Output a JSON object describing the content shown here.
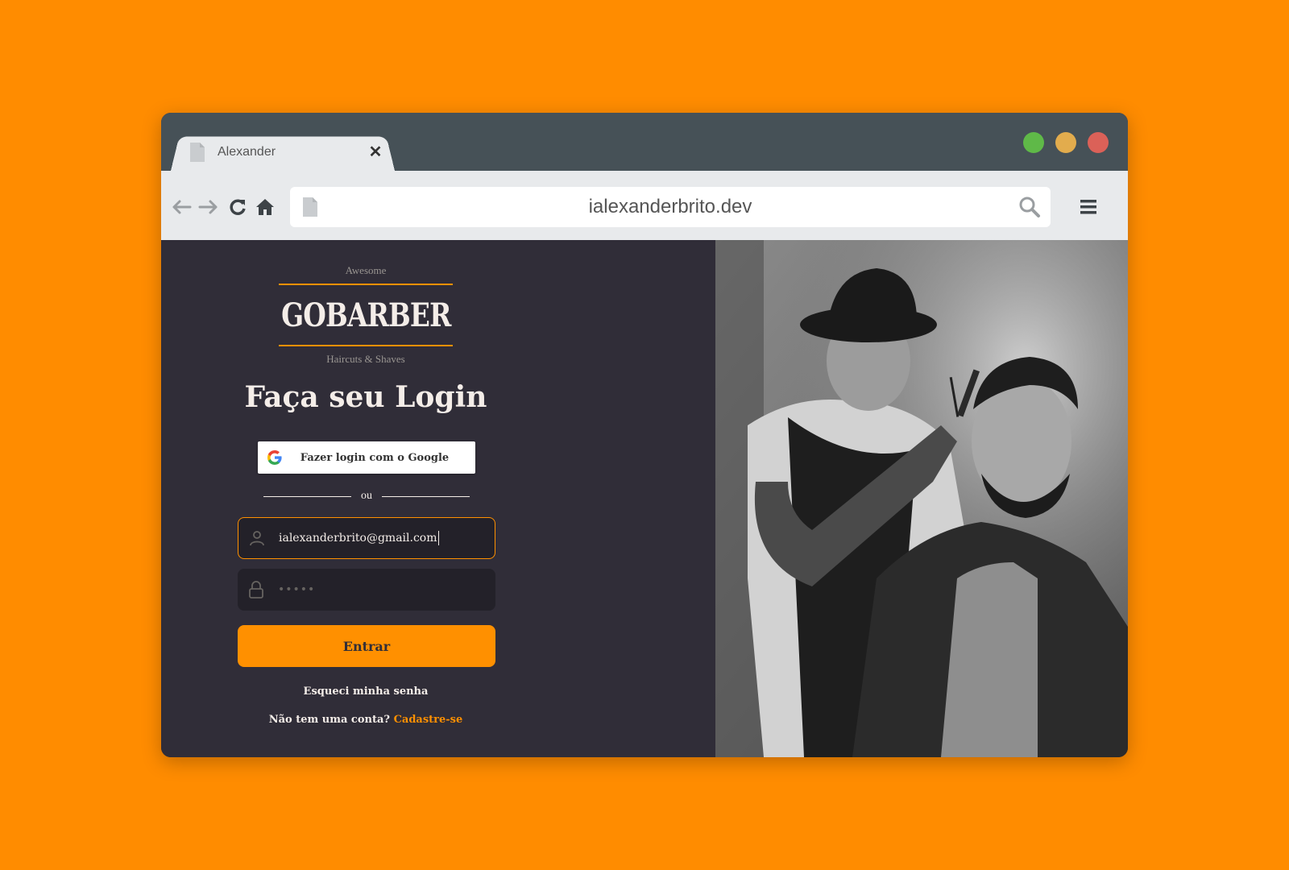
{
  "browser": {
    "tab_title": "Alexander",
    "tab_close": "✕",
    "url": "ialexanderbrito.dev",
    "traffic_lights": {
      "green": "#5fb948",
      "yellow": "#e2ac4d",
      "red": "#db6158"
    },
    "icons": [
      "back-arrow-icon",
      "forward-arrow-icon",
      "reload-icon",
      "home-icon",
      "page-icon",
      "search-icon",
      "hamburger-menu-icon",
      "close-icon"
    ]
  },
  "logo": {
    "top_text": "Awesome",
    "name": "GOBARBER",
    "bottom_text": "Haircuts & Shaves"
  },
  "login": {
    "heading": "Faça seu Login",
    "google_button": "Fazer login com o Google",
    "divider_text": "ou",
    "email_value": "ialexanderbrito@gmail.com",
    "password_mask": "•••••",
    "submit_label": "Entrar",
    "forgot_label": "Esqueci minha senha",
    "signup_prompt": "Não tem uma conta?",
    "signup_link": "Cadastre-se"
  },
  "colors": {
    "page_background": "#ff8c00",
    "accent": "#ff9000",
    "panel": "#302d38",
    "input": "#232129",
    "text": "#f4ede8"
  }
}
